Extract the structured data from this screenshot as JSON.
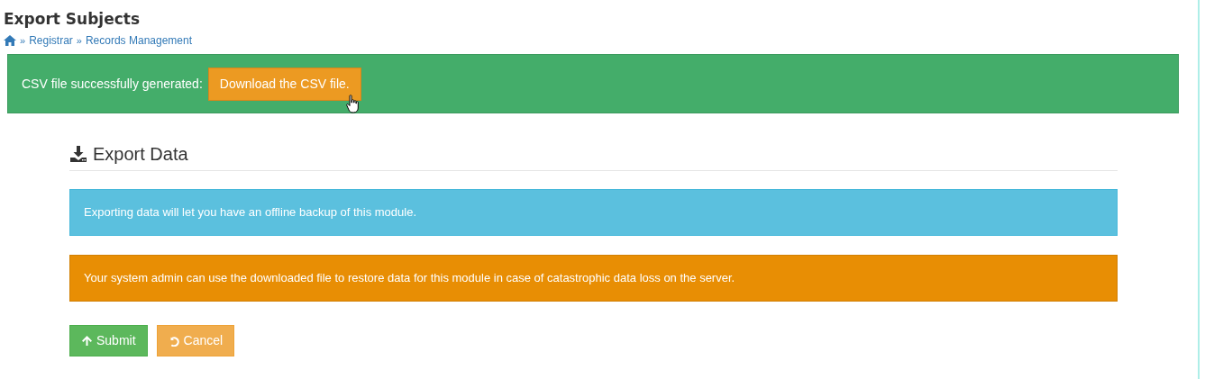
{
  "page_title": "Export Subjects",
  "breadcrumb": [
    {
      "kind": "home"
    },
    {
      "kind": "link",
      "separator": "»",
      "label": "Registrar"
    },
    {
      "kind": "link",
      "separator": "»",
      "label": "Records Management"
    }
  ],
  "success_alert": {
    "message": "CSV file successfully generated:",
    "button": "Download the CSV file."
  },
  "section": {
    "title": "Export Data"
  },
  "alerts": [
    {
      "kind": "info",
      "text": "Exporting data will let you have an offline backup of this module."
    },
    {
      "kind": "warning",
      "text": "Your system admin can use the downloaded file to restore data for this module in case of catastrophic data loss on the server."
    }
  ],
  "buttons": [
    {
      "kind": "submit",
      "label": "Submit"
    },
    {
      "kind": "cancel",
      "label": "Cancel"
    }
  ]
}
